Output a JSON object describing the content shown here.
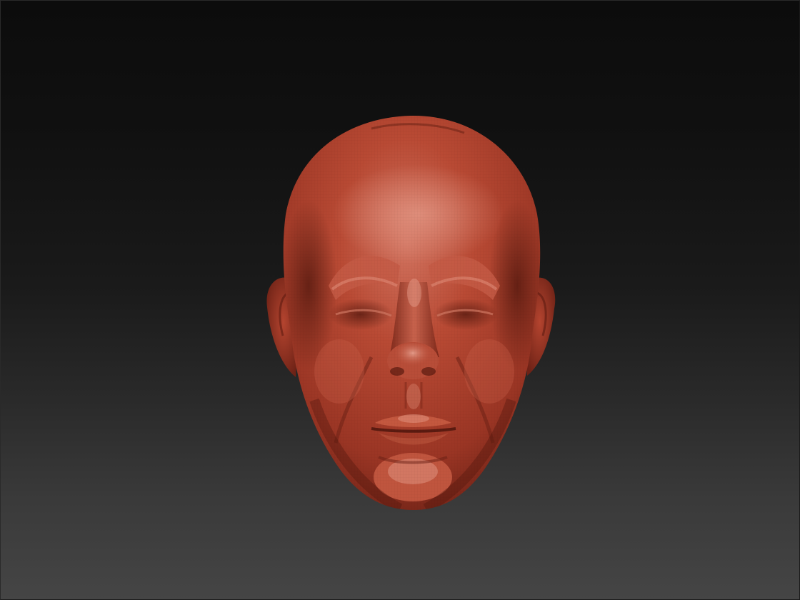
{
  "canvas": {
    "subject": "sculpted-head-model",
    "colors": {
      "background_top": "#0c0c0c",
      "background_bottom": "#454545",
      "material_base": "#b4442f",
      "material_highlight": "#d9826f",
      "material_shadow": "#5a1a10"
    }
  }
}
